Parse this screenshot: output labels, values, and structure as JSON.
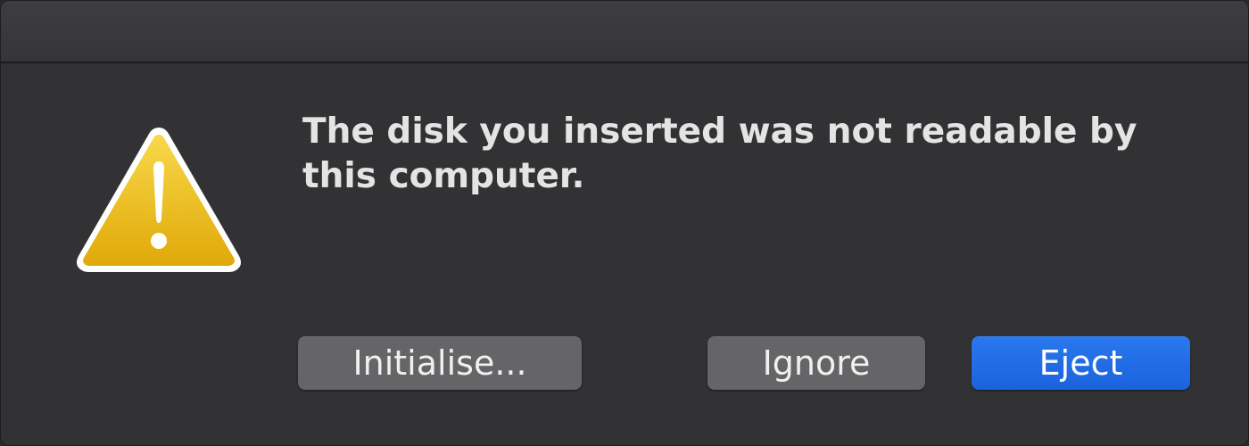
{
  "dialog": {
    "message": "The disk you inserted was not readable by this computer.",
    "icon": "warning-triangle-icon",
    "buttons": {
      "initialise": "Initialise...",
      "ignore": "Ignore",
      "eject": "Eject"
    }
  },
  "colors": {
    "background": "#323234",
    "primary_button": "#1a6ae3",
    "secondary_button": "#656567",
    "warning_yellow": "#f2c30f"
  }
}
